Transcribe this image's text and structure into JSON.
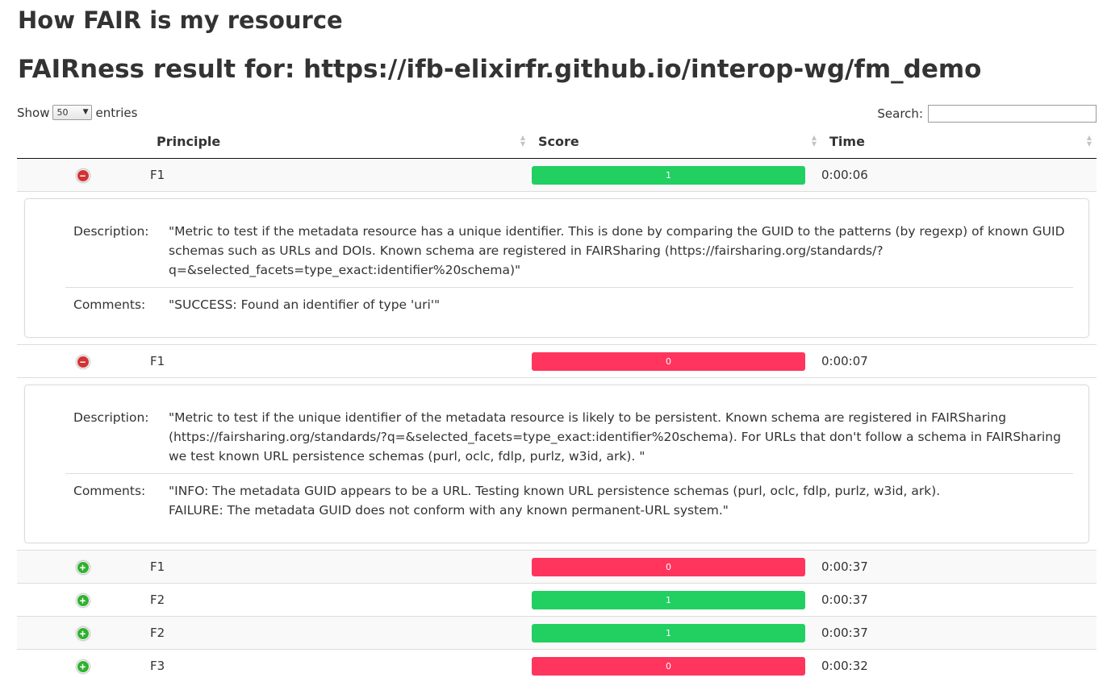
{
  "page": {
    "title": "How FAIR is my resource",
    "result_heading": "FAIRness result for: https://ifb-elixirfr.github.io/interop-wg/fm_demo"
  },
  "length_control": {
    "show_label": "Show",
    "value": "50",
    "entries_label": "entries"
  },
  "search": {
    "label": "Search:",
    "value": ""
  },
  "columns": {
    "principle": "Principle",
    "score": "Score",
    "time": "Time"
  },
  "colors": {
    "pass": "#22cf61",
    "fail": "#ff355e",
    "expanded_icon": "#d33333",
    "collapsed_icon": "#31b131"
  },
  "detail_labels": {
    "description": "Description:",
    "comments": "Comments:"
  },
  "rows": [
    {
      "principle": "F1",
      "score": "1",
      "time": "0:00:06",
      "expanded": true,
      "icon": "minus-icon",
      "description": "\"Metric to test if the metadata resource has a unique identifier. This is done by comparing the GUID to the patterns (by regexp) of known GUID schemas such as URLs and DOIs. Known schema are registered in FAIRSharing (https://fairsharing.org/standards/?q=&selected_facets=type_exact:identifier%20schema)\"",
      "comments": "\"SUCCESS: Found an identifier of type 'uri'\""
    },
    {
      "principle": "F1",
      "score": "0",
      "time": "0:00:07",
      "expanded": true,
      "icon": "minus-icon",
      "description": "\"Metric to test if the unique identifier of the metadata resource is likely to be persistent. Known schema are registered in FAIRSharing (https://fairsharing.org/standards/?q=&selected_facets=type_exact:identifier%20schema). For URLs that don't follow a schema in FAIRSharing we test known URL persistence schemas (purl, oclc, fdlp, purlz, w3id, ark). \"",
      "comments": "\"INFO: The metadata GUID appears to be a URL. Testing known URL persistence schemas (purl, oclc, fdlp, purlz, w3id, ark).\nFAILURE: The metadata GUID does not conform with any known permanent-URL system.\""
    },
    {
      "principle": "F1",
      "score": "0",
      "time": "0:00:37",
      "expanded": false,
      "icon": "plus-icon"
    },
    {
      "principle": "F2",
      "score": "1",
      "time": "0:00:37",
      "expanded": false,
      "icon": "plus-icon"
    },
    {
      "principle": "F2",
      "score": "1",
      "time": "0:00:37",
      "expanded": false,
      "icon": "plus-icon"
    },
    {
      "principle": "F3",
      "score": "0",
      "time": "0:00:32",
      "expanded": false,
      "icon": "plus-icon"
    }
  ]
}
